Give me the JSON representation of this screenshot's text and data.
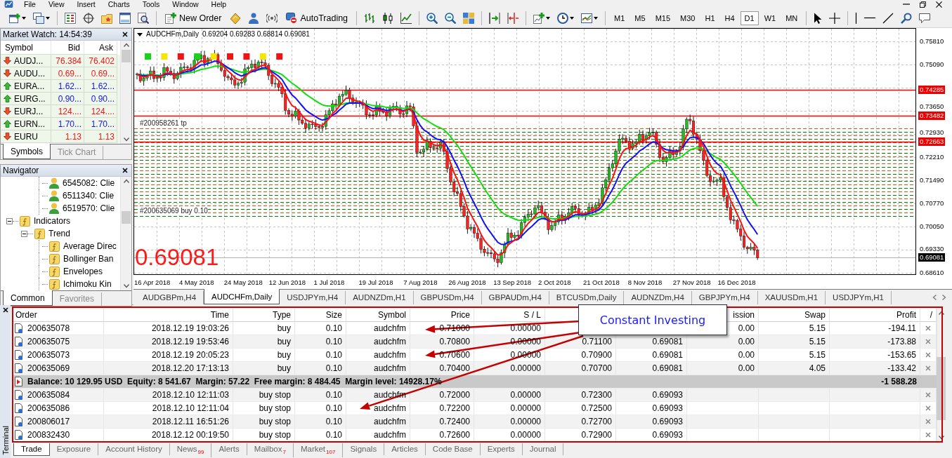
{
  "menu": [
    "File",
    "View",
    "Insert",
    "Charts",
    "Tools",
    "Window",
    "Help"
  ],
  "toolbar": {
    "new_order": "New Order",
    "auto_trading": "AutoTrading",
    "periods": [
      {
        "label": "M1",
        "selected": false
      },
      {
        "label": "M5",
        "selected": false
      },
      {
        "label": "M15",
        "selected": false
      },
      {
        "label": "M30",
        "selected": false
      },
      {
        "label": "H1",
        "selected": false
      },
      {
        "label": "H4",
        "selected": false
      },
      {
        "label": "D1",
        "selected": true
      },
      {
        "label": "W1",
        "selected": false
      },
      {
        "label": "MN",
        "selected": false
      }
    ]
  },
  "market_watch": {
    "title": "Market Watch: 14:54:39",
    "columns": [
      "Symbol",
      "Bid",
      "Ask"
    ],
    "rows": [
      {
        "symbol": "AUDJ...",
        "bid": "76.384",
        "ask": "76.402",
        "rising": false
      },
      {
        "symbol": "AUDU...",
        "bid": "0.69...",
        "ask": "0.69...",
        "rising": false
      },
      {
        "symbol": "EURA...",
        "bid": "1.62...",
        "ask": "1.62...",
        "rising": true
      },
      {
        "symbol": "EURG...",
        "bid": "0.90...",
        "ask": "0.90...",
        "rising": true
      },
      {
        "symbol": "EURJ...",
        "bid": "124....",
        "ask": "124....",
        "rising": false
      },
      {
        "symbol": "EURN...",
        "bid": "1.70...",
        "ask": "1.70...",
        "rising": true
      },
      {
        "symbol": "EURU",
        "bid": "1.13",
        "ask": "1.13",
        "rising": false
      }
    ],
    "tabs": [
      {
        "label": "Symbols",
        "selected": true
      },
      {
        "label": "Tick Chart",
        "selected": false
      }
    ]
  },
  "navigator": {
    "title": "Navigator",
    "accounts": [
      "6545082: Clie",
      "6511340: Clie",
      "6519570: Clie"
    ],
    "tree": [
      {
        "label": "Indicators",
        "expanded": true,
        "children": [
          {
            "label": "Trend",
            "expanded": true,
            "children": [
              {
                "label": "Average Direc"
              },
              {
                "label": "Bollinger Ban"
              },
              {
                "label": "Envelopes"
              },
              {
                "label": "Ichimoku Kin"
              }
            ]
          }
        ]
      }
    ],
    "tabs": [
      {
        "label": "Common",
        "selected": true
      },
      {
        "label": "Favorites",
        "selected": false
      }
    ]
  },
  "chart": {
    "symbol": "AUDCHFm,Daily",
    "ohlc": "0.69204 0.69283 0.68814 0.69081",
    "signals": [
      {
        "color": "#19d219"
      },
      {
        "color": "#f5e600"
      },
      {
        "color": "#f01414"
      },
      {
        "color": "#19d219"
      },
      {
        "color": "#f5e600"
      },
      {
        "color": "#f01414"
      },
      {
        "color": "#f01414"
      },
      {
        "color": "#f5e600"
      },
      {
        "color": "#f01414"
      }
    ],
    "order_labels": [
      "#200958261 tp",
      "#200635069 buy 0.10"
    ],
    "last_price": "0.69081",
    "price_axis": [
      {
        "label": "0.75810",
        "kind": "tick"
      },
      {
        "label": "0.75090",
        "kind": "tick"
      },
      {
        "label": "0.74285",
        "kind": "level"
      },
      {
        "label": "0.73650",
        "kind": "tick"
      },
      {
        "label": "0.73482",
        "kind": "level"
      },
      {
        "label": "0.72930",
        "kind": "tick"
      },
      {
        "label": "0.72663",
        "kind": "level"
      },
      {
        "label": "0.72210",
        "kind": "tick"
      },
      {
        "label": "0.71490",
        "kind": "tick"
      },
      {
        "label": "0.70770",
        "kind": "tick"
      },
      {
        "label": "0.70050",
        "kind": "tick"
      },
      {
        "label": "0.69330",
        "kind": "tick"
      },
      {
        "label": "0.69081",
        "kind": "bid"
      },
      {
        "label": "0.68610",
        "kind": "tick"
      }
    ],
    "dates": [
      "16 Apr 2018",
      "4 May 2018",
      "24 May 2018",
      "12 Jun 2018",
      "1 Jul 2018",
      "19 Jul 2018",
      "7 Aug 2018",
      "26 Aug 2018",
      "13 Sep 2018",
      "2 Oct 2018",
      "21 Oct 2018",
      "8 Nov 2018",
      "27 Nov 2018",
      "16 Dec 2018"
    ]
  },
  "chart_tabs": [
    {
      "label": "AUDGBPm,H4",
      "selected": false
    },
    {
      "label": "AUDCHFm,Daily",
      "selected": true
    },
    {
      "label": "USDJPYm,H4",
      "selected": false
    },
    {
      "label": "AUDNZDm,H1",
      "selected": false
    },
    {
      "label": "GBPUSDm,H4",
      "selected": false
    },
    {
      "label": "GBPAUDm,H4",
      "selected": false
    },
    {
      "label": "BTCUSDm,Daily",
      "selected": false
    },
    {
      "label": "AUDNZDm,H4",
      "selected": false
    },
    {
      "label": "GBPJPYm,H4",
      "selected": false
    },
    {
      "label": "XAUUSDm,H1",
      "selected": false
    },
    {
      "label": "USDJPYm,H1",
      "selected": false
    }
  ],
  "callout": {
    "text": "Constant Investing"
  },
  "terminal": {
    "title": "Terminal",
    "columns": [
      "Order",
      "Time",
      "Type",
      "Size",
      "Symbol",
      "Price",
      "S / L",
      null,
      null,
      "ission",
      "Swap",
      "Profit",
      "/"
    ],
    "rows": [
      {
        "kind": "order",
        "cells": [
          "200635078",
          "2018.12.19 19:03:26",
          "buy",
          "0.10",
          "audchfm",
          "0.71000",
          "0.00000",
          null,
          null,
          "0.00",
          "5.15",
          "-194.11"
        ]
      },
      {
        "kind": "order",
        "cells": [
          "200635075",
          "2018.12.19 19:53:46",
          "buy",
          "0.10",
          "audchfm",
          "0.70800",
          "0.00000",
          "0.71100",
          "0.69081",
          "0.00",
          "5.15",
          "-173.88"
        ]
      },
      {
        "kind": "order",
        "cells": [
          "200635073",
          "2018.12.19 20:05:23",
          "buy",
          "0.10",
          "audchfm",
          "0.70600",
          "0.00000",
          "0.70900",
          "0.69081",
          "0.00",
          "5.15",
          "-153.65"
        ]
      },
      {
        "kind": "order",
        "cells": [
          "200635069",
          "2018.12.20 17:13:13",
          "buy",
          "0.10",
          "audchfm",
          "0.70400",
          "0.00000",
          "0.70700",
          "0.69081",
          "0.00",
          "4.05",
          "-133.42"
        ]
      },
      {
        "kind": "summary",
        "text": "Balance: 10 129.95 USD  Equity: 8 541.67  Margin: 57.22  Free margin: 8 484.45  Margin level: 14928.17%",
        "profit": "-1 588.28"
      },
      {
        "kind": "order",
        "cells": [
          "200635084",
          "2018.12.10 12:11:03",
          "buy stop",
          "0.10",
          "audchfm",
          "0.72000",
          "0.00000",
          "0.72300",
          "0.69093",
          null,
          null,
          null
        ]
      },
      {
        "kind": "order",
        "cells": [
          "200635086",
          "2018.12.10 12:11:04",
          "buy stop",
          "0.10",
          "audchfm",
          "0.72200",
          "0.00000",
          "0.72500",
          "0.69093",
          null,
          null,
          null
        ]
      },
      {
        "kind": "order",
        "cells": [
          "200806017",
          "2018.12.11 16:51:26",
          "buy stop",
          "0.10",
          "audchfm",
          "0.72400",
          "0.00000",
          "0.72700",
          "0.69093",
          null,
          null,
          null
        ]
      },
      {
        "kind": "order",
        "cells": [
          "200832430",
          "2018.12.12 00:19:50",
          "buy stop",
          "0.10",
          "audchfm",
          "0.72600",
          "0.00000",
          "0.72900",
          "0.69093",
          null,
          null,
          null
        ]
      }
    ],
    "tabs": [
      {
        "label": "Trade",
        "selected": true
      },
      {
        "label": "Exposure",
        "selected": false
      },
      {
        "label": "Account History",
        "selected": false
      },
      {
        "label": "News",
        "badge": "99",
        "selected": false
      },
      {
        "label": "Alerts",
        "selected": false
      },
      {
        "label": "Mailbox",
        "badge": "7",
        "selected": false
      },
      {
        "label": "Market",
        "badge": "107",
        "selected": false
      },
      {
        "label": "Signals",
        "selected": false
      },
      {
        "label": "Articles",
        "selected": false
      },
      {
        "label": "Code Base",
        "selected": false
      },
      {
        "label": "Experts",
        "selected": false
      },
      {
        "label": "Journal",
        "selected": false
      }
    ]
  }
}
